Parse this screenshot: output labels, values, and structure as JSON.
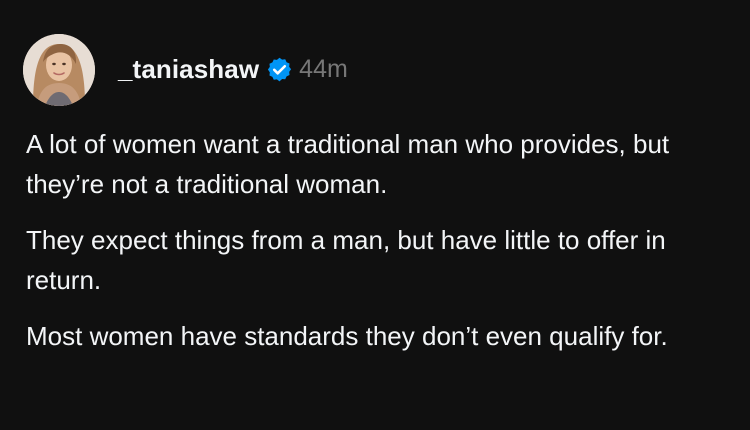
{
  "post": {
    "author": {
      "username": "_taniashaw",
      "verified_icon": "verified-badge-icon",
      "avatar_icon": "profile-photo"
    },
    "timestamp": "44m",
    "paragraphs": [
      "A lot of women want a traditional man who provides, but they’re not a traditional woman.",
      "They expect things from a man, but have little to offer in return.",
      "Most women have standards they don’t even qualify for."
    ]
  },
  "colors": {
    "background": "#101010",
    "text": "#f3f5f7",
    "muted": "#777777",
    "verified": "#0095f6"
  }
}
